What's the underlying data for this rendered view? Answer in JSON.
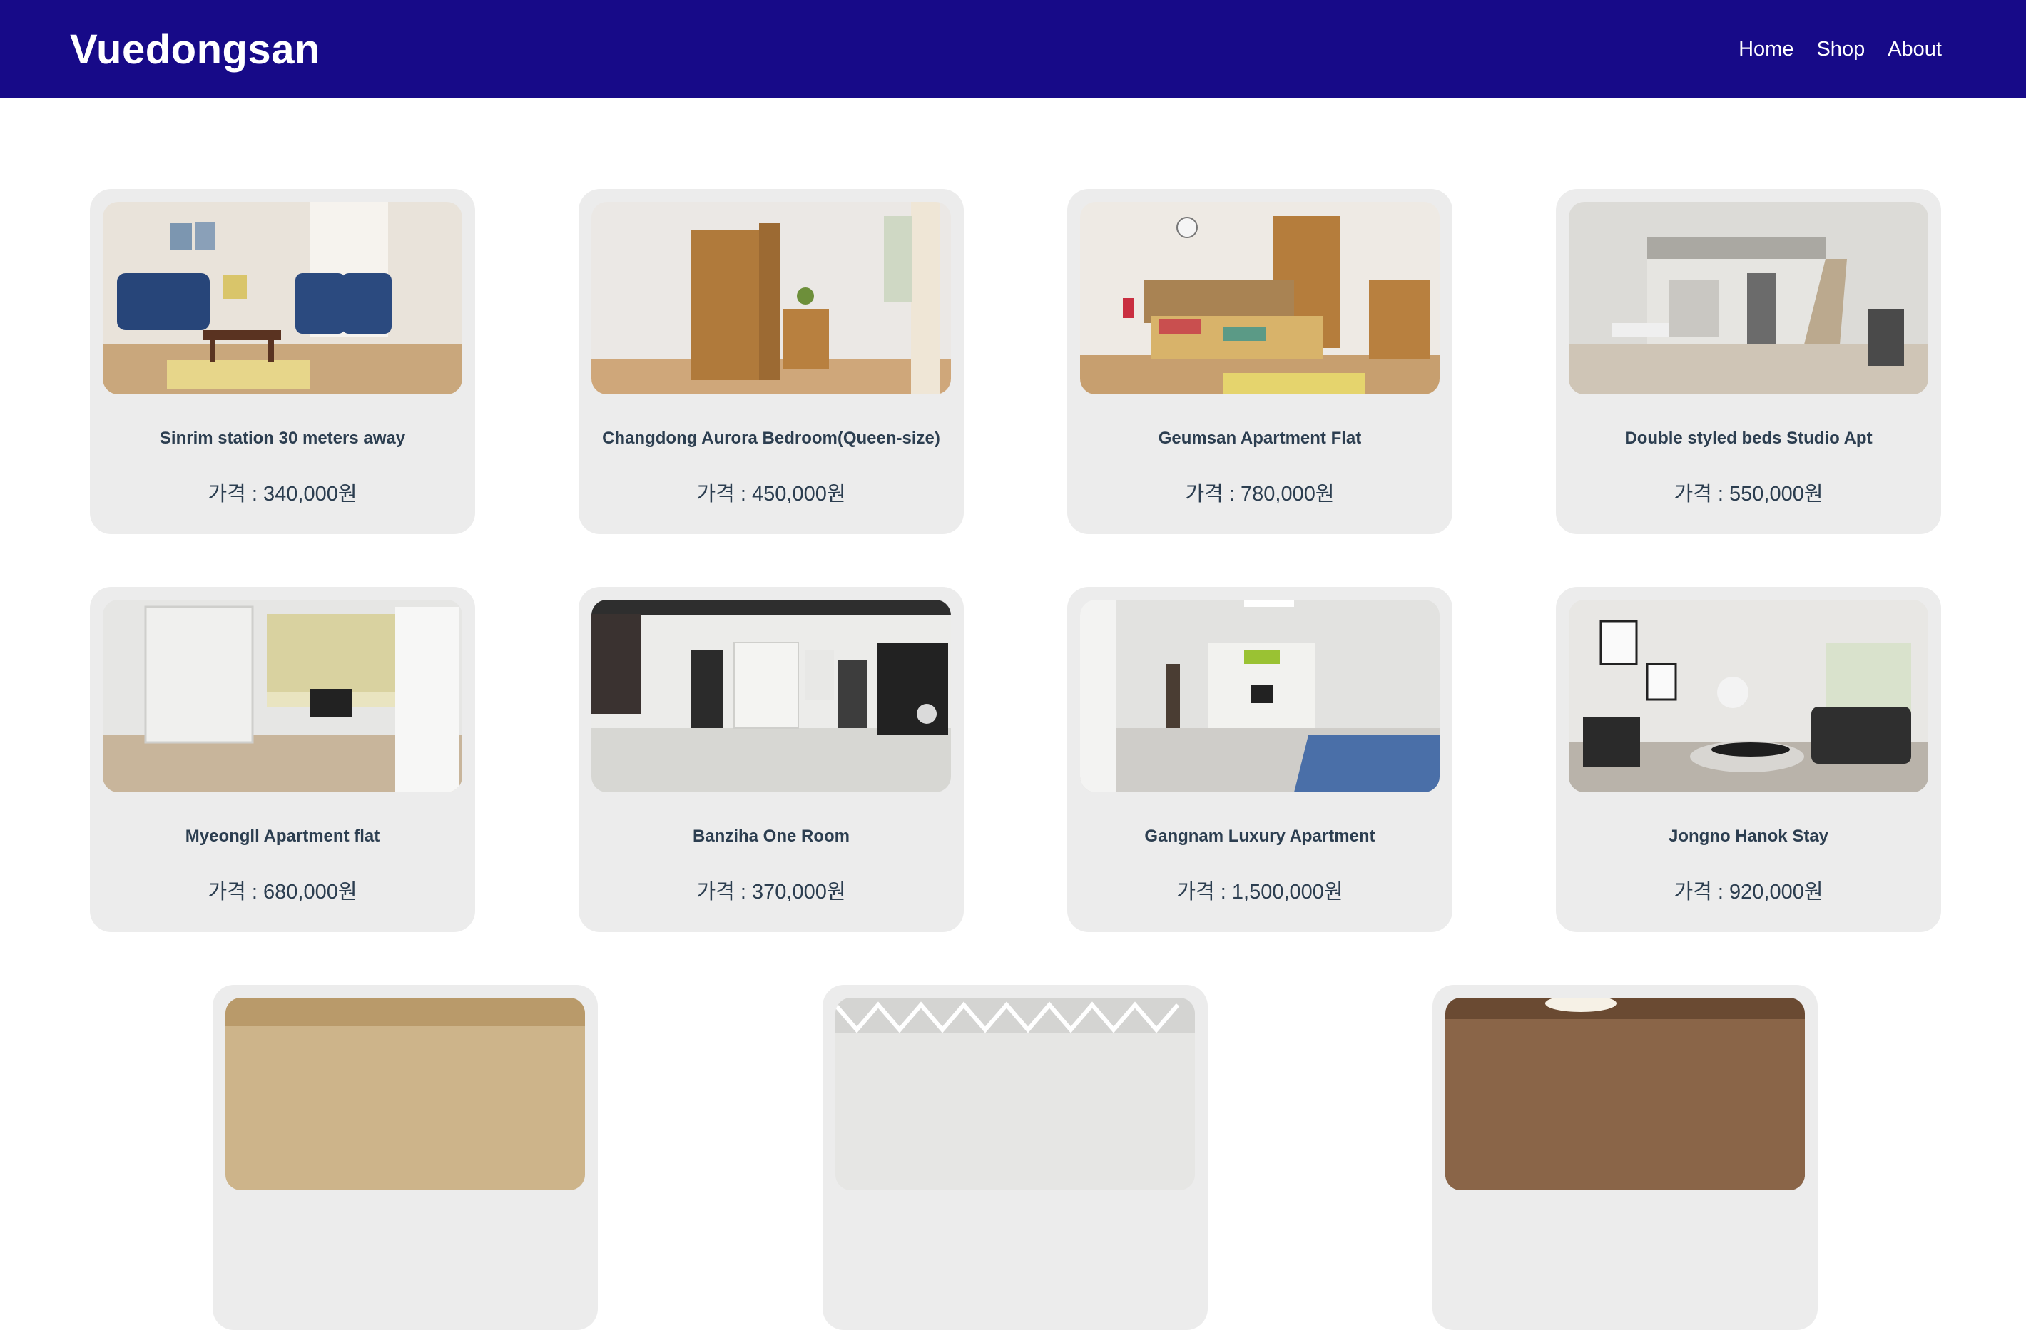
{
  "nav": {
    "brand": "Vuedongsan",
    "links": [
      "Home",
      "Shop",
      "About"
    ]
  },
  "listings": [
    {
      "title": "Sinrim station 30 meters away",
      "price": "가격 : 340,000원",
      "photo": "living-room-photo"
    },
    {
      "title": "Changdong Aurora Bedroom(Queen-size)",
      "price": "가격 : 450,000원",
      "photo": "wardrobe-room-photo"
    },
    {
      "title": "Geumsan Apartment Flat",
      "price": "가격 : 780,000원",
      "photo": "bedroom-photo"
    },
    {
      "title": "Double styled beds Studio Apt",
      "price": "가격 : 550,000원",
      "photo": "loft-studio-photo"
    },
    {
      "title": "Myeongll Apartment flat",
      "price": "가격 : 680,000원",
      "photo": "apartment-interior-photo"
    },
    {
      "title": "Banziha One Room",
      "price": "가격 : 370,000원",
      "photo": "one-room-photo"
    },
    {
      "title": "Gangnam Luxury Apartment",
      "price": "가격 : 1,500,000원",
      "photo": "studio-bed-photo"
    },
    {
      "title": "Jongno Hanok Stay",
      "price": "가격 : 920,000원",
      "photo": "modern-living-photo"
    },
    {
      "photo": "room-photo"
    },
    {
      "photo": "room-photo"
    },
    {
      "photo": "room-photo"
    }
  ]
}
